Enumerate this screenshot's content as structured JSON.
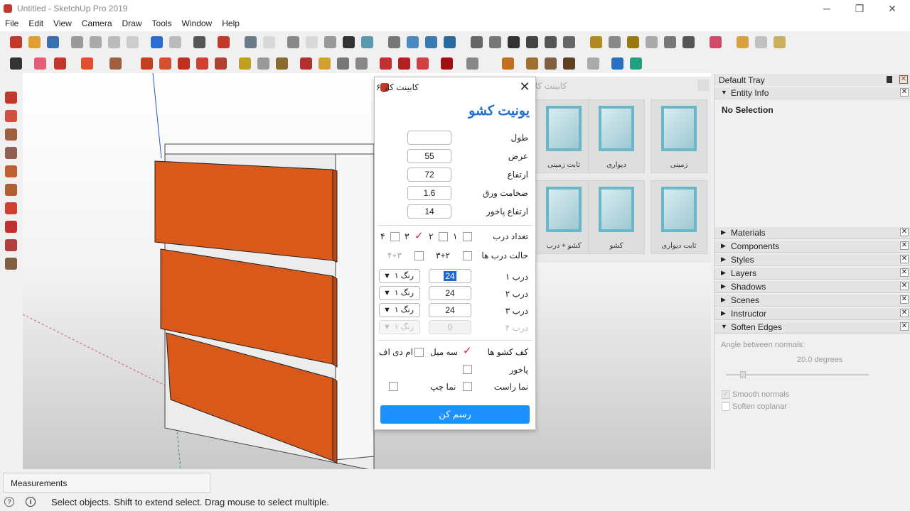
{
  "window": {
    "title": "Untitled - SketchUp Pro 2019",
    "minimize": "─",
    "maximize": "❐",
    "close": "✕"
  },
  "menu": [
    "File",
    "Edit",
    "View",
    "Camera",
    "Draw",
    "Tools",
    "Window",
    "Help"
  ],
  "gallery": {
    "title": "کابینت کا",
    "items": [
      {
        "label": "ثابت زمینی"
      },
      {
        "label": "دیواری"
      },
      {
        "label": "زمینی"
      },
      {
        "label": "کشو + درب"
      },
      {
        "label": "کشو"
      },
      {
        "label": "ثابت دیواری"
      }
    ]
  },
  "dialog": {
    "title": "کابینت کار ۶",
    "close": "✕",
    "heading": "یونیت کشو",
    "fields": [
      {
        "label": "طول",
        "value": ""
      },
      {
        "label": "عرض",
        "value": "55"
      },
      {
        "label": "ارتفاع",
        "value": "72"
      },
      {
        "label": "ضخامت ورق",
        "value": "1.6"
      },
      {
        "label": "ارتفاع پاخور",
        "value": "14"
      }
    ],
    "door_count": {
      "label": "تعداد درب",
      "options": [
        "۱",
        "۲",
        "۳",
        "۴"
      ],
      "checked": "۳"
    },
    "door_mode": {
      "label": "حالت درب ها",
      "options": [
        "۳+۲",
        "۴+۳"
      ]
    },
    "doors": [
      {
        "label": "درب ۱",
        "value": "24",
        "color": "رنگ ۱",
        "arrow": "▼"
      },
      {
        "label": "درب ۲",
        "value": "24",
        "color": "رنگ ۱",
        "arrow": "▼"
      },
      {
        "label": "درب ۳",
        "value": "24",
        "color": "رنگ ۱",
        "arrow": "▼"
      },
      {
        "label": "درب ۴",
        "value": "0",
        "color": "رنگ ۱",
        "arrow": "▼"
      }
    ],
    "drawer_floor": {
      "label": "کف کشو ها",
      "opt1": "سه میل",
      "opt2": "ام دی اف"
    },
    "pakhor": {
      "label": "پاخور"
    },
    "face_right": {
      "label": "نما راست"
    },
    "face_left": {
      "label": "نما چپ"
    },
    "draw_button": "رسم کن"
  },
  "tray": {
    "title": "Default Tray",
    "entity_info": {
      "name": "Entity Info",
      "selection": "No Selection"
    },
    "panels": [
      "Materials",
      "Components",
      "Styles",
      "Layers",
      "Shadows",
      "Scenes",
      "Instructor"
    ],
    "soften": {
      "name": "Soften Edges",
      "angle_label": "Angle between normals:",
      "angle_value": "20.0  degrees",
      "smooth": "Smooth normals",
      "coplanar": "Soften coplanar"
    }
  },
  "status": {
    "measurements": "Measurements",
    "message": "Select objects. Shift to extend select. Drag mouse to select multiple."
  },
  "colors": {
    "drawer_front": "#d9591a",
    "accent": "#1e90ff",
    "heading": "#1f6fcf"
  }
}
